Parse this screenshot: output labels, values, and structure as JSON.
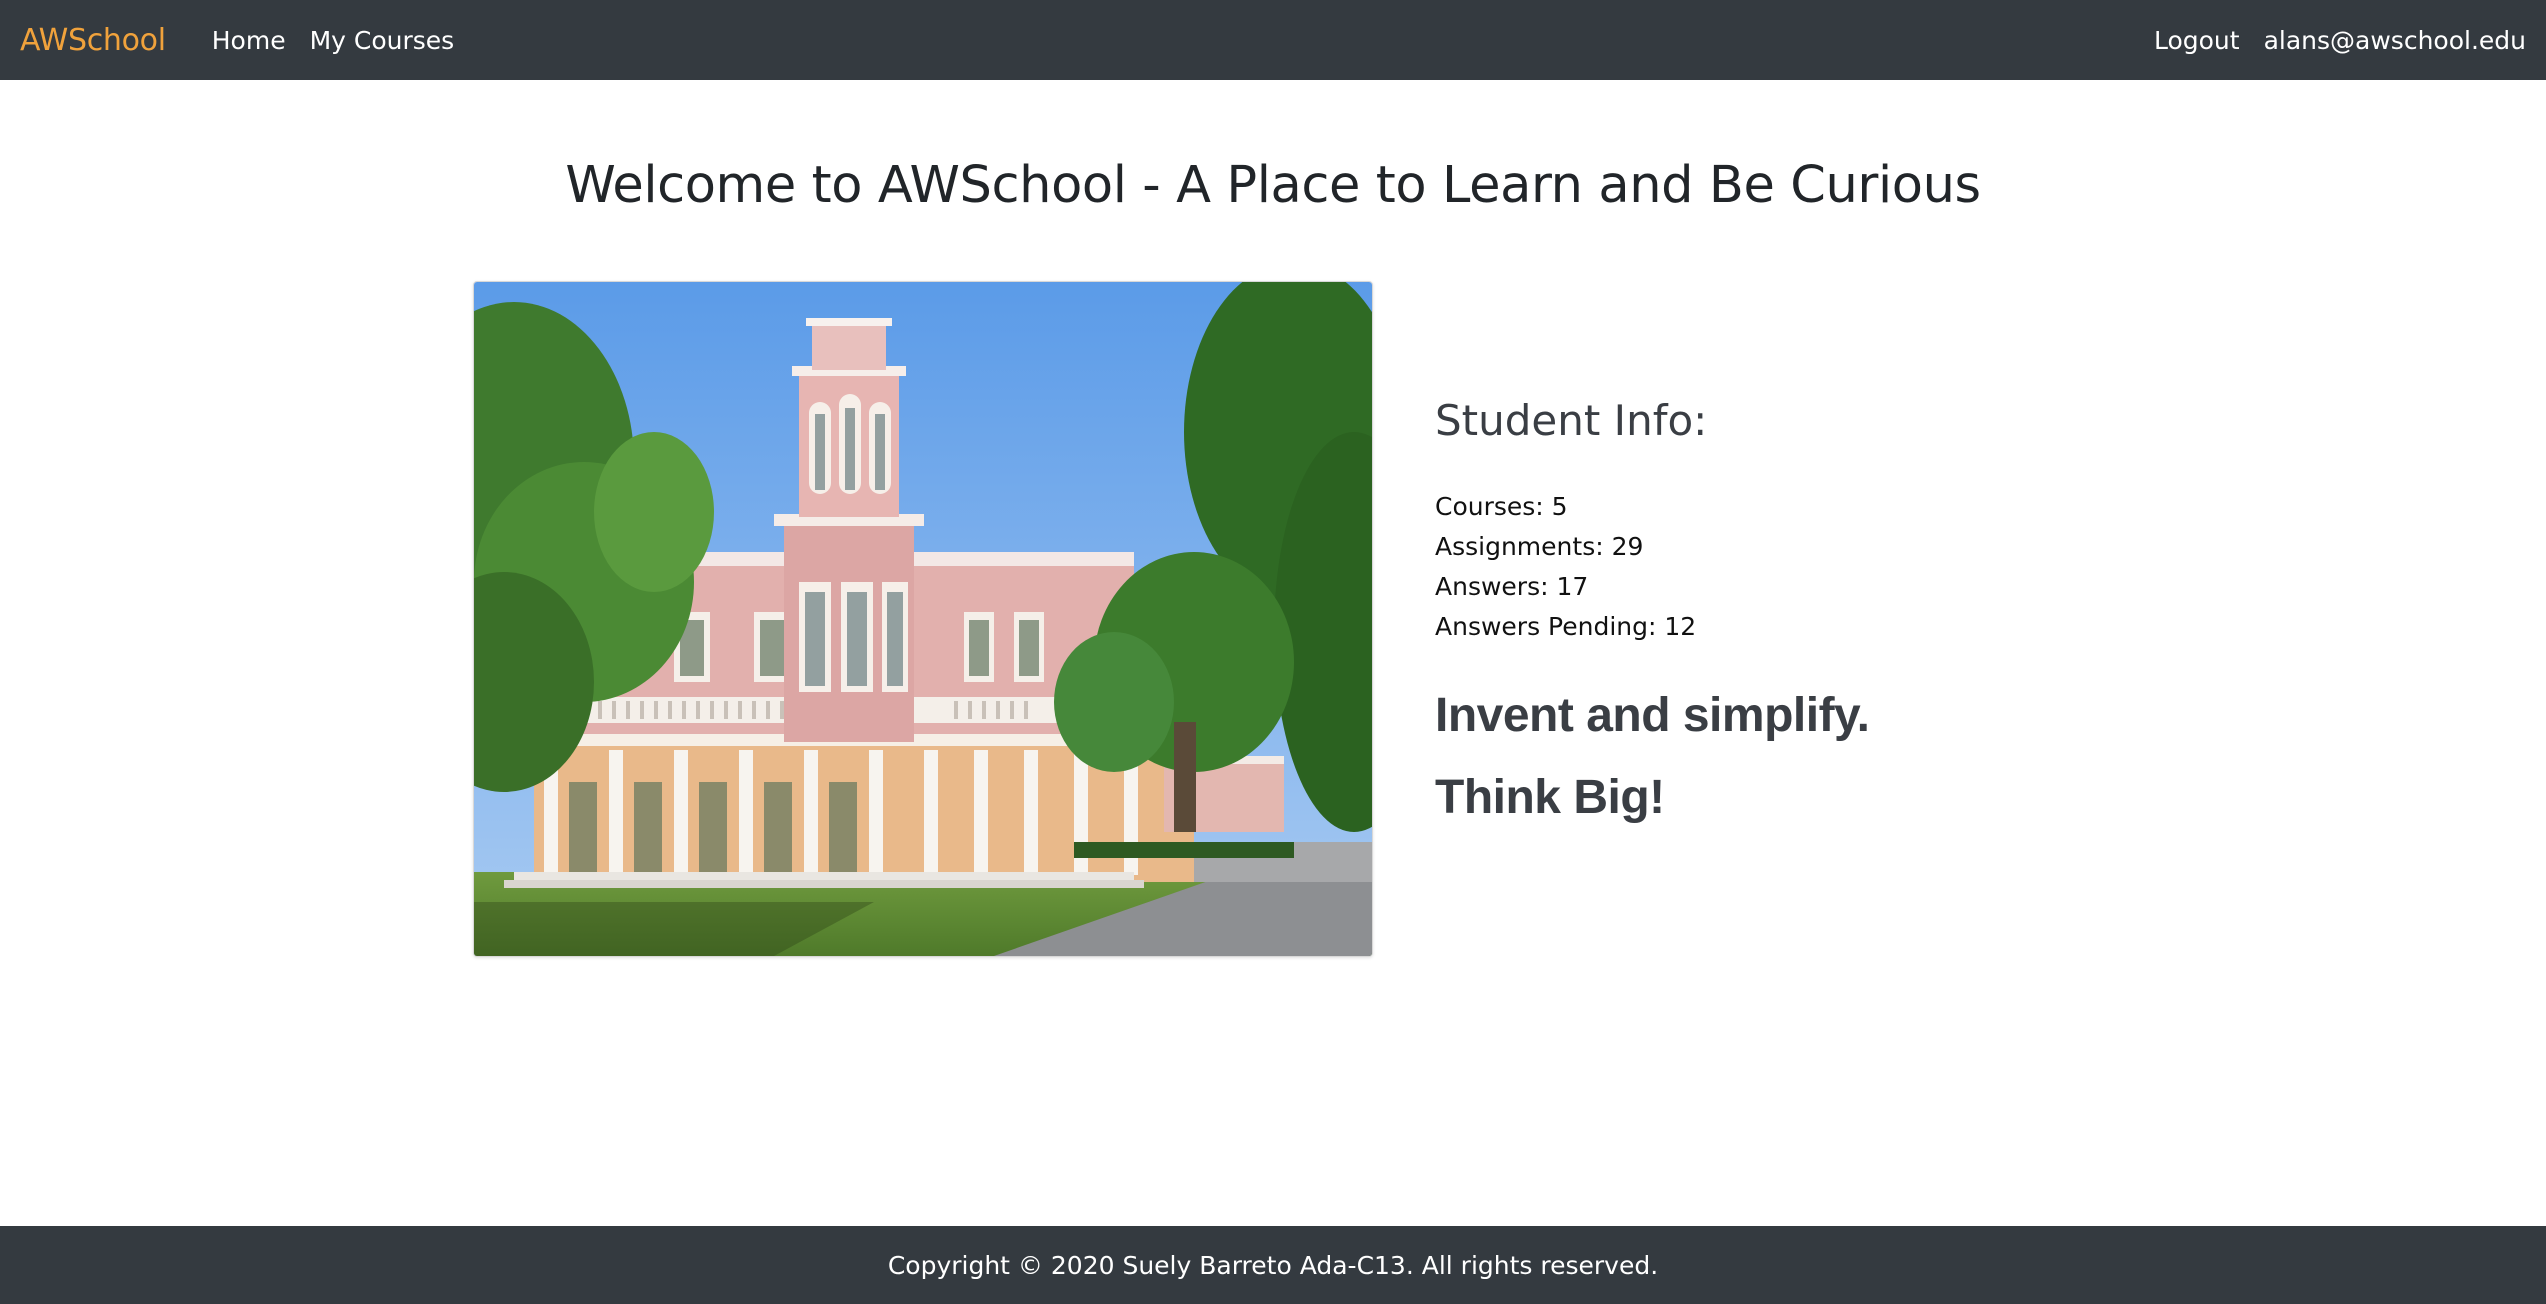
{
  "navbar": {
    "brand": "AWSchool",
    "links": [
      {
        "label": "Home"
      },
      {
        "label": "My Courses"
      }
    ],
    "logout_label": "Logout",
    "user_email": "alans@awschool.edu"
  },
  "main": {
    "title": "Welcome to AWSchool - A Place to Learn and Be Curious",
    "student_info": {
      "heading": "Student Info:",
      "courses": "Courses: 5",
      "assignments": "Assignments: 29",
      "answers": "Answers: 17",
      "answers_pending": "Answers Pending: 12"
    },
    "mottos": [
      "Invent and simplify.",
      "Think Big!"
    ]
  },
  "footer": {
    "copyright": "Copyright © 2020 Suely Barreto Ada-C13. All rights reserved."
  },
  "colors": {
    "navbar_bg": "#343a40",
    "brand": "#f0a23c",
    "footer_bg": "#343a40"
  }
}
